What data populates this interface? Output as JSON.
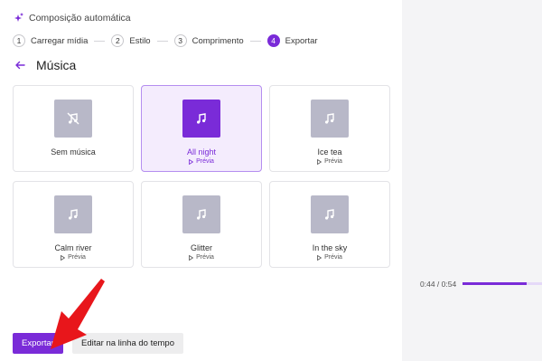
{
  "header": {
    "title": "Composição automática",
    "icon": "sparkle-icon"
  },
  "steps": [
    {
      "num": "1",
      "label": "Carregar mídia",
      "active": false
    },
    {
      "num": "2",
      "label": "Estilo",
      "active": false
    },
    {
      "num": "3",
      "label": "Comprimento",
      "active": false
    },
    {
      "num": "4",
      "label": "Exportar",
      "active": true
    }
  ],
  "section": {
    "title": "Música",
    "back_icon": "arrow-left-icon"
  },
  "music": [
    {
      "label": "Sem música",
      "preview": "",
      "selected": false,
      "icon": "music-off-icon"
    },
    {
      "label": "All night",
      "preview": "Prévia",
      "selected": true,
      "icon": "music-note-icon"
    },
    {
      "label": "Ice tea",
      "preview": "Prévia",
      "selected": false,
      "icon": "music-note-icon"
    },
    {
      "label": "Calm river",
      "preview": "Prévia",
      "selected": false,
      "icon": "music-note-icon"
    },
    {
      "label": "Glitter",
      "preview": "Prévia",
      "selected": false,
      "icon": "music-note-icon"
    },
    {
      "label": "In the sky",
      "preview": "Prévia",
      "selected": false,
      "icon": "music-note-icon"
    }
  ],
  "buttons": {
    "export": "Exportar",
    "timeline": "Editar na linha do tempo"
  },
  "player": {
    "time": "0:44 / 0:54",
    "progress": 0.81
  },
  "colors": {
    "accent": "#7a2bd8",
    "selected_bg": "#f4ecfd",
    "thumb": "#b8b8c8",
    "annotation": "#e8161b"
  }
}
